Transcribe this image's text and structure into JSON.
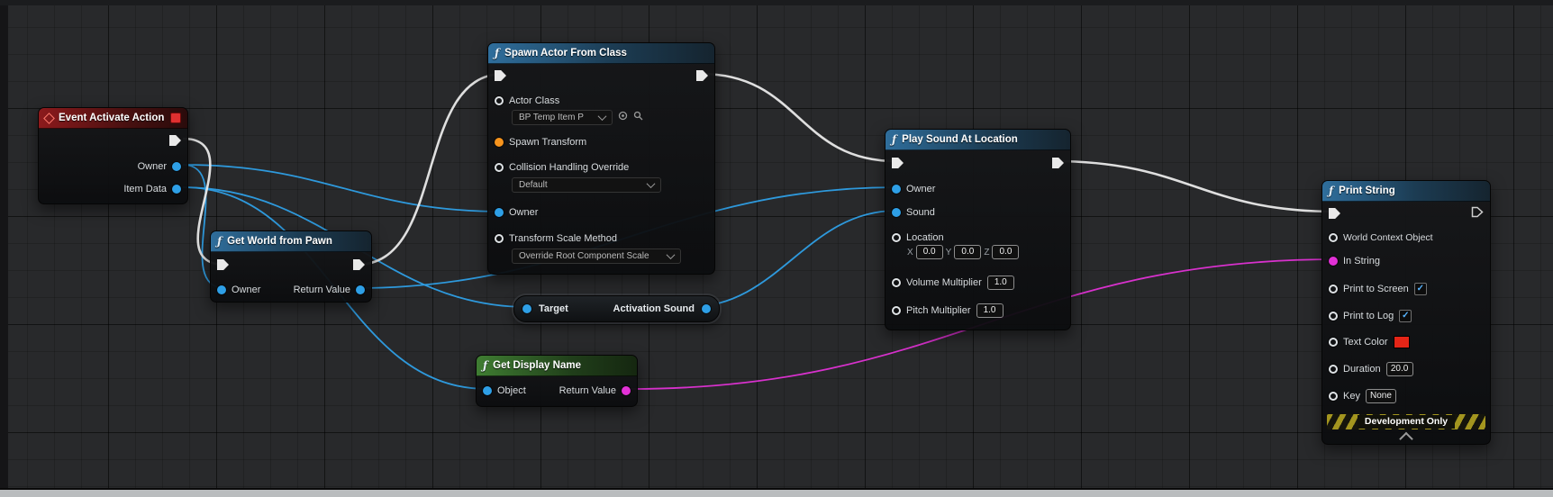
{
  "palette": {
    "exec": "#e9e9e9",
    "object": "#2e9fe6",
    "string": "#e231d6",
    "float": "#6ee03a",
    "bool": "#d0342c",
    "vector": "#f0c420",
    "name": "#bd94e8",
    "struct": "#3f6fd8",
    "transform": "#f7941d",
    "enum": "#2fae66",
    "header_fn": "#2f6e9c",
    "header_event": "#8c1a1c",
    "header_pure": "#3f7d32"
  },
  "nodes": {
    "event": {
      "title": "Event Activate Action",
      "pin_owner": "Owner",
      "pin_item_data": "Item Data"
    },
    "get_world": {
      "title": "Get World from Pawn",
      "pin_owner": "Owner",
      "pin_return": "Return Value"
    },
    "spawn": {
      "title": "Spawn Actor From Class",
      "pin_actor_class": "Actor Class",
      "actor_class_value": "BP Temp Item P",
      "pin_spawn_transform": "Spawn Transform",
      "pin_collision": "Collision Handling Override",
      "collision_value": "Default",
      "pin_owner": "Owner",
      "pin_scale_method": "Transform Scale Method",
      "scale_method_value": "Override Root Component Scale"
    },
    "activation_sound": {
      "pin_target": "Target",
      "pin_out": "Activation Sound"
    },
    "get_display_name": {
      "title": "Get Display Name",
      "pin_object": "Object",
      "pin_return": "Return Value"
    },
    "play_sound": {
      "title": "Play Sound At Location",
      "pin_owner": "Owner",
      "pin_sound": "Sound",
      "pin_location": "Location",
      "axis_x": "X",
      "axis_y": "Y",
      "axis_z": "Z",
      "x_value": "0.0",
      "y_value": "0.0",
      "z_value": "0.0",
      "pin_volume": "Volume Multiplier",
      "volume_value": "1.0",
      "pin_pitch": "Pitch Multiplier",
      "pitch_value": "1.0"
    },
    "print_string": {
      "title": "Print String",
      "pin_world_context": "World Context Object",
      "pin_in_string": "In String",
      "pin_print_screen": "Print to Screen",
      "pin_print_log": "Print to Log",
      "pin_text_color": "Text Color",
      "pin_duration": "Duration",
      "duration_value": "20.0",
      "pin_key": "Key",
      "key_value": "None",
      "dev_only": "Development Only"
    }
  }
}
